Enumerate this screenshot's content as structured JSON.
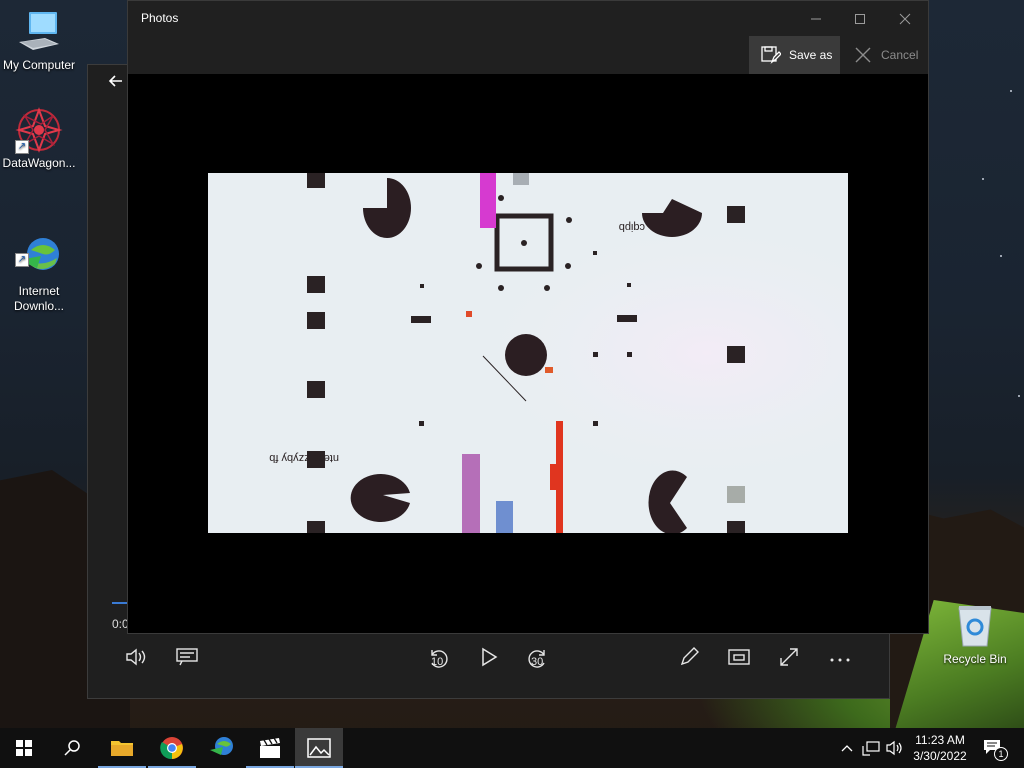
{
  "desktop": {
    "icons": [
      {
        "label": "My Computer"
      },
      {
        "label": "DataWagon..."
      },
      {
        "label": "Internet\nDownlo..."
      },
      {
        "label": "Recycle Bin"
      }
    ]
  },
  "media_player": {
    "time": "0:0",
    "progress_fraction": 0.02,
    "controls": [
      {
        "icon": "volume-icon"
      },
      {
        "icon": "captions-icon"
      },
      {
        "icon": "rewind-10-icon",
        "text": "10"
      },
      {
        "icon": "play-icon"
      },
      {
        "icon": "forward-30-icon",
        "text": "30"
      },
      {
        "icon": "edit-pen-icon"
      },
      {
        "icon": "mini-view-icon"
      },
      {
        "icon": "fullscreen-icon"
      },
      {
        "icon": "more-icon"
      }
    ]
  },
  "photos": {
    "title": "Photos",
    "save_label": "Save as",
    "cancel_label": "Cancel",
    "image_text_1": "cqipb",
    "image_text_2": "ntecs zzyby fb"
  },
  "taskbar": {
    "items": [
      "start",
      "search",
      "file-explorer",
      "chrome",
      "internet-download-manager",
      "video-editor",
      "photos"
    ],
    "clock_time": "11:23 AM",
    "clock_date": "3/30/2022",
    "notification_count": "1"
  },
  "colors": {
    "taskbar_bg": "#101010",
    "window_bg": "#202020",
    "accent": "#7aa7e0"
  }
}
